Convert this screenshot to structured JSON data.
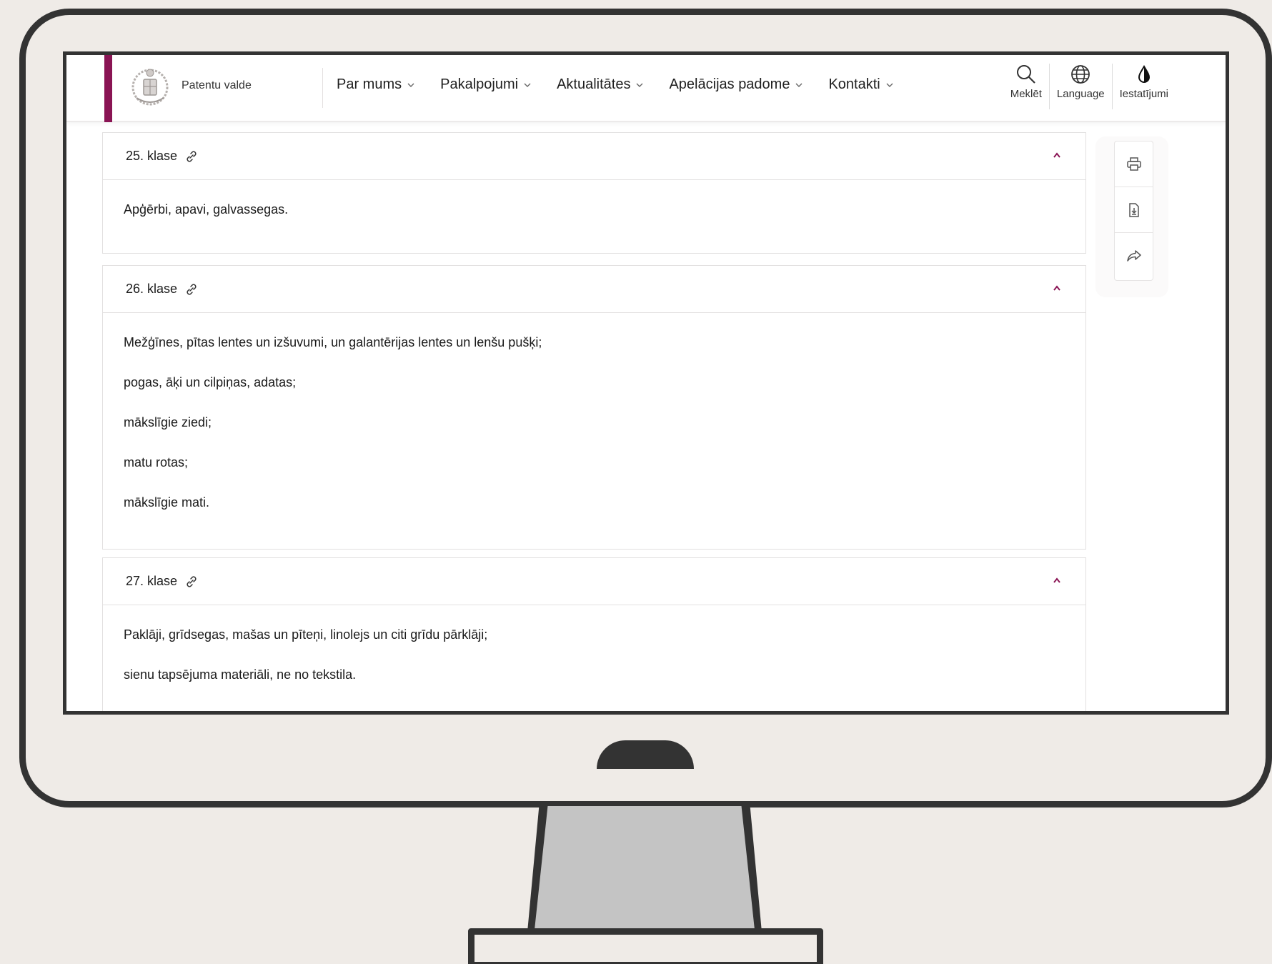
{
  "header": {
    "org_name": "Patentu valde",
    "nav": [
      {
        "label": "Par mums"
      },
      {
        "label": "Pakalpojumi"
      },
      {
        "label": "Aktualitātes"
      },
      {
        "label": "Apelācijas padome"
      },
      {
        "label": "Kontakti"
      }
    ],
    "tools": {
      "search_label": "Meklēt",
      "language_label": "Language",
      "settings_label": "Iestatījumi"
    }
  },
  "classes": [
    {
      "title": "25. klase",
      "lines": [
        "Apģērbi, apavi, galvassegas."
      ]
    },
    {
      "title": "26. klase",
      "lines": [
        "Mežģīnes, pītas lentes un izšuvumi, un galantērijas lentes un lenšu pušķi;",
        "pogas, āķi un cilpiņas, adatas;",
        "mākslīgie ziedi;",
        "matu rotas;",
        "mākslīgie mati."
      ]
    },
    {
      "title": "27. klase",
      "lines": [
        "Paklāji, grīdsegas, mašas un pīteņi, linolejs un citi grīdu pārklāji;",
        "sienu tapsējuma materiāli, ne no tekstila."
      ]
    }
  ],
  "colors": {
    "brand": "#8a1454",
    "accent_caret": "#8a1454"
  },
  "side_tools": [
    "printer-icon",
    "download-document-icon",
    "share-icon"
  ]
}
